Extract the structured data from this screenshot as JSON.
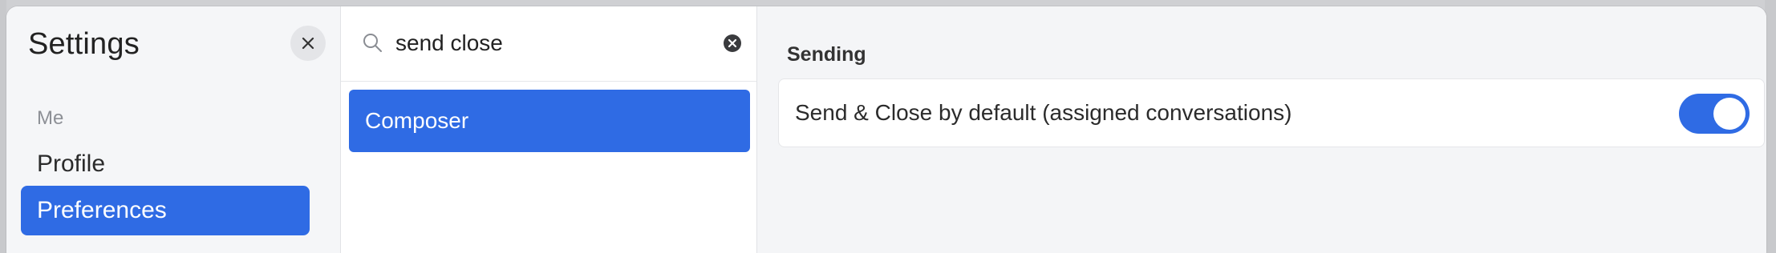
{
  "sidebar": {
    "title": "Settings",
    "close_icon": "close-icon",
    "section_label": "Me",
    "items": [
      {
        "label": "Profile",
        "selected": false
      },
      {
        "label": "Preferences",
        "selected": true
      }
    ]
  },
  "search": {
    "value": "send close",
    "search_icon": "search-icon",
    "clear_icon": "clear-circle-icon",
    "results": [
      {
        "label": "Composer",
        "selected": true
      }
    ]
  },
  "content": {
    "section_heading": "Sending",
    "settings": [
      {
        "label": "Send & Close by default (assigned conversations)",
        "enabled": true
      }
    ]
  },
  "colors": {
    "accent": "#2f6be4",
    "window_bg": "#f4f5f7",
    "panel_bg": "#ffffff"
  }
}
